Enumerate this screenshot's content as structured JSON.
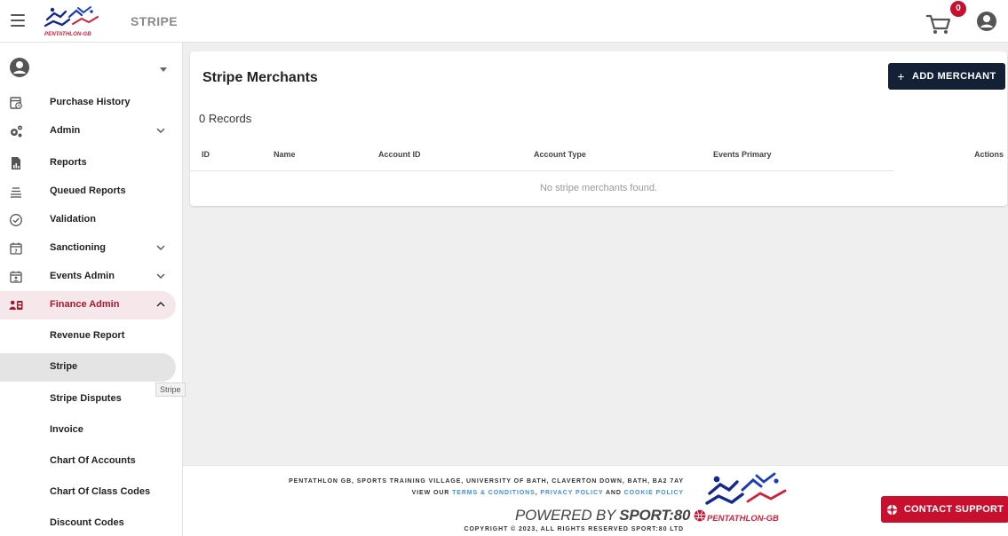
{
  "header": {
    "app_title": "STRIPE",
    "cart_count": "0",
    "brand_text": "PENTATHLON-GB",
    "icons": {
      "menu": "hamburger-icon",
      "cart": "cart-icon",
      "account": "account-circle-icon"
    }
  },
  "sidebar": {
    "user_name": "",
    "items": [
      {
        "label": "Purchase History",
        "icon": "receipt-clock-icon"
      },
      {
        "label": "Admin",
        "icon": "gears-icon",
        "expandable": true
      },
      {
        "label": "Reports",
        "icon": "report-file-icon"
      },
      {
        "label": "Queued Reports",
        "icon": "queue-list-icon"
      },
      {
        "label": "Validation",
        "icon": "check-circle-icon"
      },
      {
        "label": "Sanctioning",
        "icon": "calendar-question-icon",
        "expandable": true
      },
      {
        "label": "Events Admin",
        "icon": "calendar-person-icon",
        "expandable": true
      },
      {
        "label": "Finance Admin",
        "icon": "finance-people-icon",
        "expandable": true,
        "expanded": true
      },
      {
        "label": "Revenue Report"
      },
      {
        "label": "Stripe",
        "selected": true
      },
      {
        "label": "Stripe Disputes"
      },
      {
        "label": "Invoice"
      },
      {
        "label": "Chart Of Accounts"
      },
      {
        "label": "Chart Of Class Codes"
      },
      {
        "label": "Discount Codes"
      }
    ],
    "tooltip": "Stripe"
  },
  "main": {
    "title": "Stripe Merchants",
    "add_button": "ADD MERCHANT",
    "records": "0 Records",
    "columns": [
      "ID",
      "Name",
      "Account ID",
      "Account Type",
      "Events Primary",
      "Actions"
    ],
    "empty_message": "No stripe merchants found."
  },
  "footer": {
    "address": "PENTATHLON GB, SPORTS TRAINING VILLAGE, UNIVERSITY OF BATH, CLAVERTON DOWN, BATH, BA2 7AY",
    "links_prefix": "VIEW OUR",
    "terms": "TERMS & CONDITIONS",
    "privacy": "PRIVACY POLICY",
    "and_text": "AND",
    "cookie": "COOKIE POLICY",
    "powered_prefix": "POWERED BY",
    "powered_brand": "SPORT:80",
    "copyright": "COPYRIGHT © 2023, ALL RIGHTS RESERVED SPORT:80 LTD",
    "brand_text": "PENTATHLON-GB",
    "support_button": "CONTACT SUPPORT"
  },
  "colors": {
    "accent": "#a6192e",
    "active_bg": "#f6e7ea",
    "selected_bg": "#e4e4e4",
    "primary_button": "#132036",
    "support_button": "#c8102e",
    "link": "#3f8fd8"
  }
}
